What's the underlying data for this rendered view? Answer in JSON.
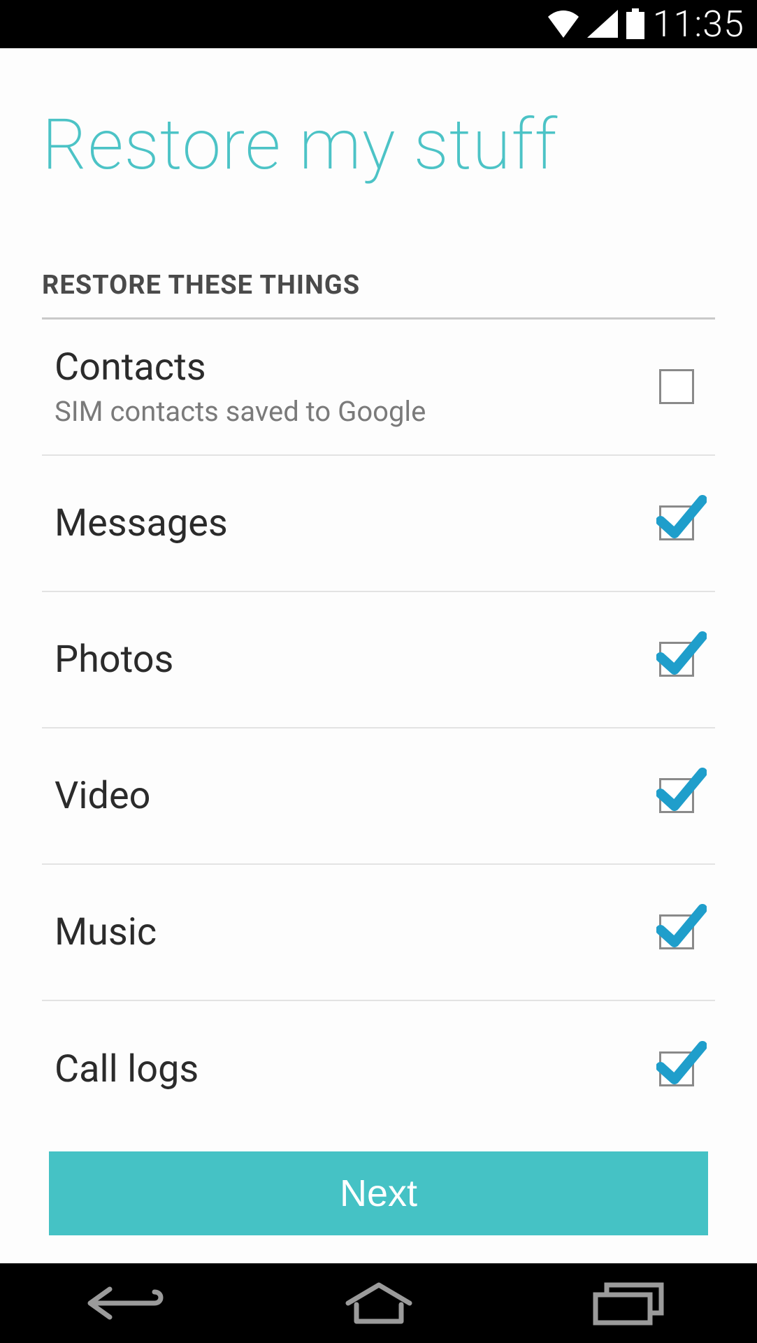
{
  "status": {
    "time": "11:35"
  },
  "page": {
    "title": "Restore my stuff",
    "section_header": "RESTORE THESE THINGS",
    "next_label": "Next"
  },
  "items": [
    {
      "title": "Contacts",
      "subtitle": "SIM contacts saved to Google",
      "checked": false
    },
    {
      "title": "Messages",
      "subtitle": "",
      "checked": true
    },
    {
      "title": "Photos",
      "subtitle": "",
      "checked": true
    },
    {
      "title": "Video",
      "subtitle": "",
      "checked": true
    },
    {
      "title": "Music",
      "subtitle": "",
      "checked": true
    },
    {
      "title": "Call logs",
      "subtitle": "",
      "checked": true
    }
  ]
}
